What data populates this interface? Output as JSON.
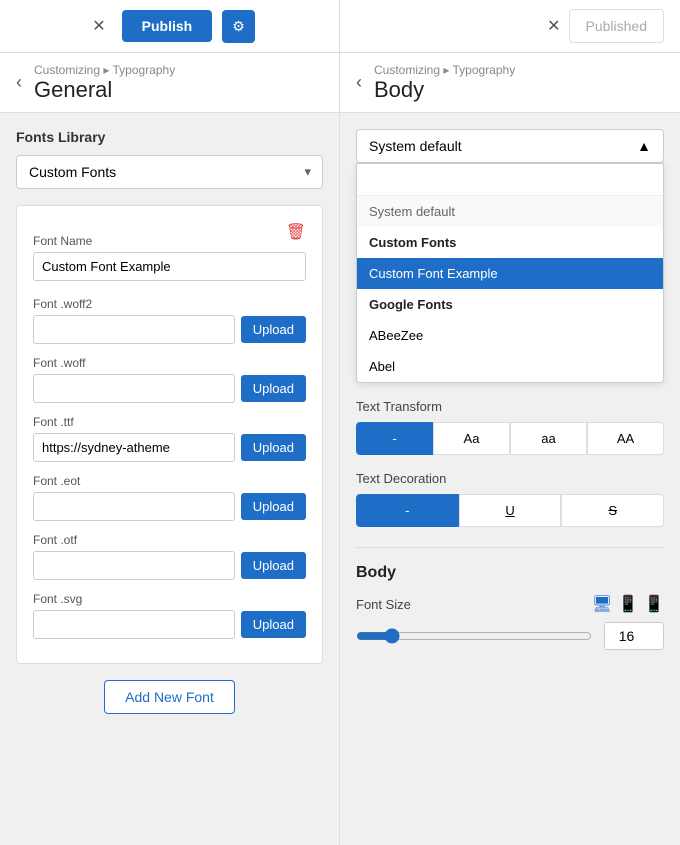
{
  "topbar": {
    "close_left": "✕",
    "publish_label": "Publish",
    "gear_label": "⚙",
    "close_right": "✕",
    "published_label": "Published"
  },
  "left_panel": {
    "back": "‹",
    "breadcrumb": "Customizing ▸ Typography",
    "page_title": "General",
    "fonts_library_label": "Fonts Library",
    "fonts_dropdown_value": "Custom Fonts",
    "fonts_dropdown_arrow": "▾",
    "font_card": {
      "font_name_label": "Font Name",
      "font_name_value": "Custom Font Example",
      "woff2_label": "Font .woff2",
      "woff2_value": "",
      "woff_label": "Font .woff",
      "woff_value": "",
      "ttf_label": "Font .ttf",
      "ttf_value": "https://sydney-atheme",
      "eot_label": "Font .eot",
      "eot_value": "",
      "otf_label": "Font .otf",
      "otf_value": "",
      "svg_label": "Font .svg",
      "svg_value": "",
      "upload_label": "Upload"
    },
    "add_new_label": "Add New Font"
  },
  "right_panel": {
    "back": "‹",
    "breadcrumb": "Customizing ▸ Typography",
    "page_title": "Body",
    "dropdown_trigger": "System default",
    "dropdown_arrow": "▲",
    "search_placeholder": "",
    "dropdown_items": [
      {
        "label": "System default",
        "type": "system-default"
      },
      {
        "label": "Custom Fonts",
        "type": "group-header"
      },
      {
        "label": "Custom Font Example",
        "type": "selected"
      },
      {
        "label": "Google Fonts",
        "type": "group-header"
      },
      {
        "label": "ABeeZee",
        "type": "item"
      },
      {
        "label": "Abel",
        "type": "item"
      }
    ],
    "text_transform_label": "Text Transform",
    "transform_buttons": [
      {
        "label": "-",
        "active": true
      },
      {
        "label": "Aa",
        "active": false
      },
      {
        "label": "aa",
        "active": false
      },
      {
        "label": "AA",
        "active": false
      }
    ],
    "text_decoration_label": "Text Decoration",
    "decoration_buttons": [
      {
        "label": "-",
        "active": true
      },
      {
        "label": "U̲",
        "active": false
      },
      {
        "label": "S̶",
        "active": false
      }
    ],
    "body_title": "Body",
    "font_size_label": "Font Size",
    "font_size_value": "16",
    "slider_value": 16
  }
}
